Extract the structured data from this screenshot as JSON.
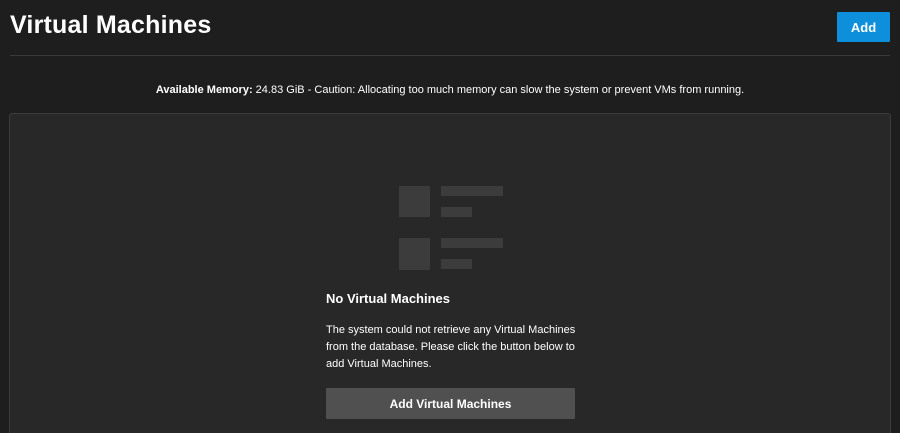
{
  "header": {
    "title": "Virtual Machines",
    "add_label": "Add"
  },
  "memory": {
    "label": "Available Memory:",
    "text": " 24.83 GiB - Caution: Allocating too much memory can slow the system or prevent VMs from running."
  },
  "empty_state": {
    "icon": "list-placeholder-icon",
    "title": "No Virtual Machines",
    "message": "The system could not retrieve any Virtual Machines from the database. Please click the button below to add Virtual Machines.",
    "button_label": "Add Virtual Machines"
  },
  "colors": {
    "background": "#1e1e1e",
    "panel": "#282828",
    "primary_button": "#0d8fdc",
    "secondary_button": "#505050",
    "icon_blocks": "#3c3c3c"
  }
}
